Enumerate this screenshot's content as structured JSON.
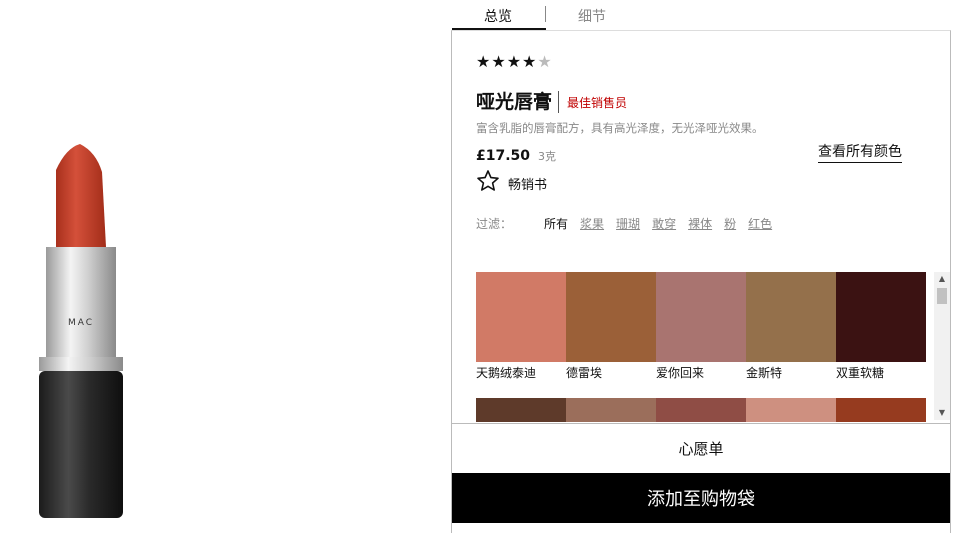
{
  "tabs": [
    {
      "label": "总览",
      "active": true
    },
    {
      "label": "细节",
      "active": false
    }
  ],
  "product": {
    "rating": 4.5,
    "title": "哑光唇膏",
    "badge": "最佳销售员",
    "description": "富含乳脂的唇膏配方，具有高光泽度，无光泽哑光效果。",
    "price": "£17.50",
    "weight": "3克",
    "view_all_colors": "查看所有颜色",
    "favorite_label": "畅销书",
    "brand_colors": {
      "lipstick": "#c9432c",
      "badge": "#c00000"
    }
  },
  "filters": {
    "label": "过滤：",
    "items": [
      "所有",
      "浆果",
      "珊瑚",
      "敢穿",
      "裸体",
      "粉",
      "红色"
    ],
    "active_index": 0
  },
  "swatches": [
    {
      "name": "天鹅绒泰迪",
      "color": "#d17a66"
    },
    {
      "name": "德雷埃",
      "color": "#9b6038"
    },
    {
      "name": "爱你回来",
      "color": "#a97470"
    },
    {
      "name": "金斯特",
      "color": "#94704b"
    },
    {
      "name": "双重软糖",
      "color": "#3b1212"
    },
    {
      "name": "",
      "color": "#5e3a2a"
    },
    {
      "name": "",
      "color": "#9b6e5b"
    },
    {
      "name": "",
      "color": "#8f4d45"
    },
    {
      "name": "",
      "color": "#ce9080"
    },
    {
      "name": "",
      "color": "#963b1f"
    }
  ],
  "actions": {
    "wishlist": "心愿单",
    "add_to_bag": "添加至购物袋"
  }
}
